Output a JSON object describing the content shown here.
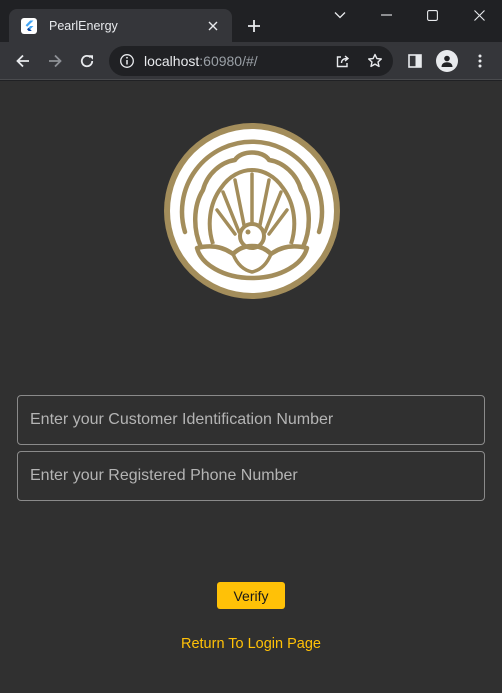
{
  "browser": {
    "tab": {
      "title": "PearlEnergy",
      "favicon": "flutter-icon",
      "close_icon": "close-icon"
    },
    "new_tab_icon": "plus-icon",
    "window_controls": [
      "chevron-down-icon",
      "minimize-icon",
      "maximize-icon",
      "close-icon"
    ],
    "toolbar": {
      "back_icon": "arrow-left-icon",
      "forward_icon": "arrow-right-icon",
      "reload_icon": "reload-icon",
      "site_info_icon": "info-icon",
      "url_host": "localhost",
      "url_rest": ":60980/#/",
      "share_icon": "share-icon",
      "bookmark_icon": "star-icon",
      "side_panel_icon": "side-panel-icon",
      "profile_icon": "person-icon",
      "menu_icon": "kebab-menu-icon"
    }
  },
  "page": {
    "logo_icon": "pearl-shell-logo",
    "cin_field": {
      "placeholder": "Enter your Customer Identification Number",
      "value": ""
    },
    "phone_field": {
      "placeholder": "Enter your Registered Phone Number",
      "value": ""
    },
    "verify_label": "Verify",
    "return_link": "Return To Login Page"
  },
  "colors": {
    "accent": "#ffc107",
    "logo_gold": "#a38d5b",
    "page_background": "#303030",
    "browser_frame": "#202124",
    "toolbar": "#35363a"
  }
}
